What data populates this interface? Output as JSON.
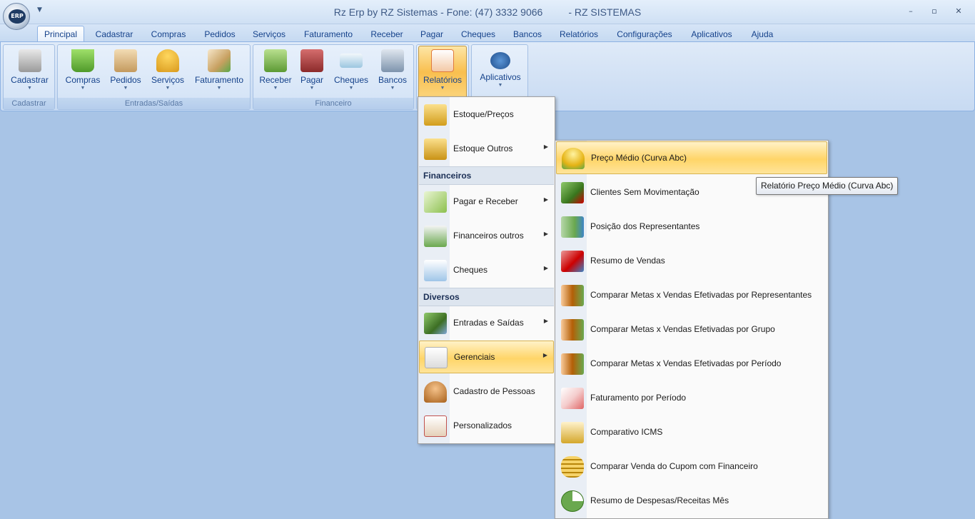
{
  "window": {
    "title": "Rz Erp by RZ Sistemas - Fone: (47) 3332 9066",
    "title_suffix": "- RZ SISTEMAS",
    "orb_text": "ERP",
    "minimize": "–",
    "restore": "▫",
    "close": "✕"
  },
  "tabs": [
    "Principal",
    "Cadastrar",
    "Compras",
    "Pedidos",
    "Serviços",
    "Faturamento",
    "Receber",
    "Pagar",
    "Cheques",
    "Bancos",
    "Relatórios",
    "Configurações",
    "Aplicativos",
    "Ajuda"
  ],
  "ribbon": {
    "groups": [
      {
        "label": "Cadastrar"
      },
      {
        "label": "Entradas/Saídas"
      },
      {
        "label": "Financeiro"
      },
      {
        "label": ""
      },
      {
        "label": ""
      }
    ],
    "buttons": [
      {
        "label": "Cadastrar",
        "icon": "cabinet-icon",
        "color": "#b8b8b8"
      },
      {
        "label": "Compras",
        "icon": "basket-icon",
        "color": "#6fbf3b"
      },
      {
        "label": "Pedidos",
        "icon": "clipboard-icon",
        "color": "#d8b27a"
      },
      {
        "label": "Serviços",
        "icon": "worker-icon",
        "color": "#f0b830"
      },
      {
        "label": "Faturamento",
        "icon": "invoice-icon",
        "color": "#c7a060"
      },
      {
        "label": "Receber",
        "icon": "money-in-icon",
        "color": "#6aa84f"
      },
      {
        "label": "Pagar",
        "icon": "wallet-icon",
        "color": "#b04545"
      },
      {
        "label": "Cheques",
        "icon": "cheque-icon",
        "color": "#7fb6d8"
      },
      {
        "label": "Bancos",
        "icon": "bank-icon",
        "color": "#8fa4bf"
      },
      {
        "label": "Relatórios",
        "icon": "report-icon",
        "color": "#e8743b"
      },
      {
        "label": "Aplicativos",
        "icon": "rz-logo-icon",
        "color": "#2f6db5"
      }
    ]
  },
  "menu_relatorios": {
    "items": [
      {
        "label": "Estoque/Preços",
        "icon": "box-search-icon",
        "color": "#e3b83c",
        "submenu": false
      },
      {
        "label": "Estoque Outros",
        "icon": "box-icon",
        "color": "#e3b83c",
        "submenu": true
      },
      {
        "section": "Financeiros"
      },
      {
        "label": "Pagar e Receber",
        "icon": "calculator-money-icon",
        "color": "#8cc04f",
        "submenu": true
      },
      {
        "label": "Financeiros outros",
        "icon": "money-chart-icon",
        "color": "#6aa84f",
        "submenu": true
      },
      {
        "label": "Cheques",
        "icon": "cheque-icon",
        "color": "#9fc5e8",
        "submenu": true
      },
      {
        "section": "Diversos"
      },
      {
        "label": "Entradas e Saídas",
        "icon": "transfer-icon",
        "color": "#5d8a3a",
        "submenu": true
      },
      {
        "label": "Gerenciais",
        "icon": "line-chart-icon",
        "color": "#e6e6e6",
        "submenu": true
      },
      {
        "label": "Cadastro de Pessoas",
        "icon": "person-icon",
        "color": "#d08a3c",
        "submenu": false
      },
      {
        "label": "Personalizados",
        "icon": "custom-report-icon",
        "color": "#c0504d",
        "submenu": false
      }
    ]
  },
  "menu_gerenciais": {
    "items": [
      {
        "label": "Preço Médio (Curva Abc)",
        "icon": "coin-person-icon",
        "color": "#f1c232"
      },
      {
        "label": "Clientes Sem Movimentação",
        "icon": "people-remove-icon",
        "color": "#38761d"
      },
      {
        "label": "Posição dos Representantes",
        "icon": "bar-person-icon",
        "color": "#6aa84f"
      },
      {
        "label": "Resumo de Vendas",
        "icon": "sales-chart-icon",
        "color": "#cc0000"
      },
      {
        "label": "Comparar Metas x Vendas Efetivadas por Representantes",
        "icon": "target-chart-icon",
        "color": "#b45f06"
      },
      {
        "label": "Comparar Metas x Vendas Efetivadas por Grupo",
        "icon": "target-chart-icon",
        "color": "#b45f06"
      },
      {
        "label": "Comparar Metas x Vendas Efetivadas por Período",
        "icon": "target-chart-icon",
        "color": "#b45f06"
      },
      {
        "label": "Faturamento por Período",
        "icon": "invoice-clock-icon",
        "color": "#e06666"
      },
      {
        "label": "Comparativo ICMS",
        "icon": "scale-icon",
        "color": "#d4a72c"
      },
      {
        "label": "Comparar Venda do Cupom com Financeiro",
        "icon": "coins-icon",
        "color": "#d6a520"
      },
      {
        "label": "Resumo de Despesas/Receitas Mês",
        "icon": "pie-chart-icon",
        "color": "#6aa84f"
      }
    ]
  },
  "tooltip": "Relatório Preço Médio (Curva Abc)"
}
